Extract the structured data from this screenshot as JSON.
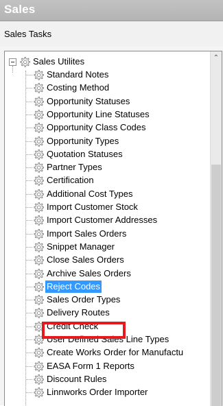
{
  "window": {
    "title": "Sales"
  },
  "tasks": {
    "title": "Sales Tasks"
  },
  "tree": {
    "root_label": "Sales Utilites",
    "items": [
      {
        "label": "Standard Notes"
      },
      {
        "label": "Costing Method"
      },
      {
        "label": "Opportunity Statuses"
      },
      {
        "label": "Opportunity Line Statuses"
      },
      {
        "label": "Opportunity Class Codes"
      },
      {
        "label": "Opportunity Types"
      },
      {
        "label": "Quotation Statuses"
      },
      {
        "label": "Partner Types"
      },
      {
        "label": "Certification"
      },
      {
        "label": "Additional Cost Types"
      },
      {
        "label": "Import Customer Stock"
      },
      {
        "label": "Import Customer Addresses"
      },
      {
        "label": "Import Sales Orders"
      },
      {
        "label": "Snippet Manager"
      },
      {
        "label": "Close Sales Orders"
      },
      {
        "label": "Archive Sales Orders"
      },
      {
        "label": "Reject Codes",
        "selected": true
      },
      {
        "label": "Sales Order Types"
      },
      {
        "label": "Delivery Routes"
      },
      {
        "label": "Credit Check"
      },
      {
        "label": "User Defined Sales Line Types"
      },
      {
        "label": "Create Works Order for Manufactu"
      },
      {
        "label": "EASA Form 1 Reports"
      },
      {
        "label": "Discount Rules"
      },
      {
        "label": "Linnworks Order Importer"
      }
    ]
  },
  "colors": {
    "selection": "#3399ff",
    "highlight_border": "#e8191e"
  },
  "icons": {
    "node": "gear-icon",
    "expander": "collapse-icon"
  }
}
